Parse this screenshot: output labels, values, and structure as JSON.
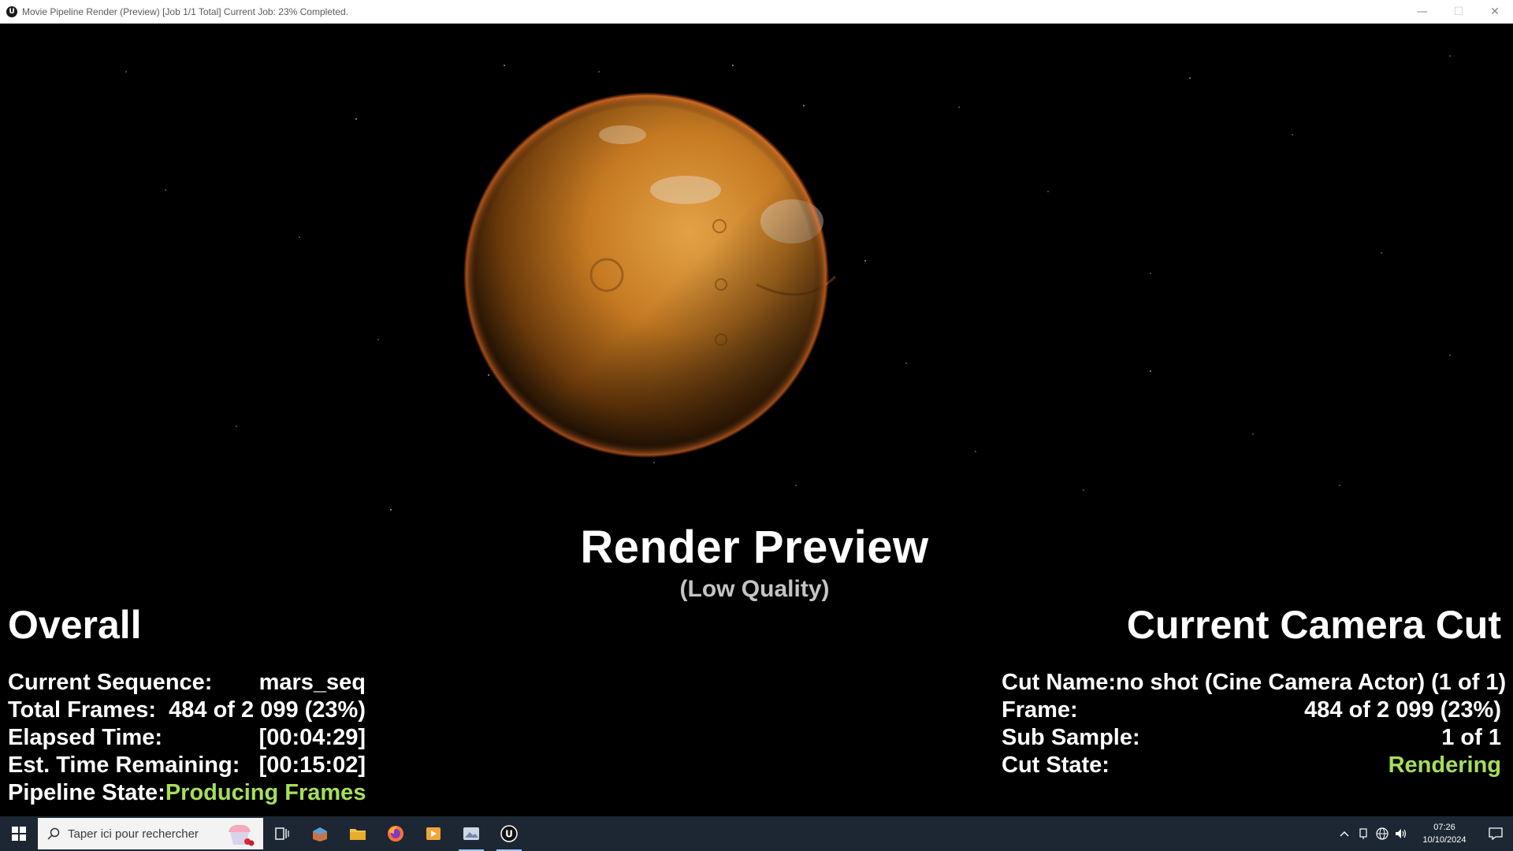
{
  "window": {
    "title": "Movie Pipeline Render (Preview) [Job 1/1 Total] Current Job: 23% Completed.",
    "logo_glyph": "U",
    "controls": [
      "—",
      "☐",
      "✕"
    ]
  },
  "preview": {
    "title": "Render Preview",
    "subtitle": "(Low Quality)"
  },
  "overall": {
    "heading": "Overall",
    "rows": [
      {
        "label": "Current Sequence:",
        "value": "mars_seq"
      },
      {
        "label": "Total Frames:",
        "value": "484 of 2 099 (23%)"
      },
      {
        "label": "Elapsed Time:",
        "value": "[00:04:29]"
      },
      {
        "label": "Est. Time Remaining:",
        "value": "[00:15:02]"
      },
      {
        "label": "Pipeline State:",
        "value": "Producing Frames"
      }
    ]
  },
  "camera_cut": {
    "heading": "Current Camera Cut",
    "rows": [
      {
        "label": "Cut Name:",
        "value": "no shot (Cine Camera Actor) (1 of 1)"
      },
      {
        "label": "Frame:",
        "value": "484 of 2 099 (23%)"
      },
      {
        "label": "Sub Sample:",
        "value": "1 of 1"
      },
      {
        "label": "Cut State:",
        "value": "Rendering"
      }
    ]
  },
  "colors": {
    "status_green": "#a6df5a",
    "taskbar": "#1c2733",
    "planet": "#c57a22"
  },
  "taskbar": {
    "search_placeholder": "Taper ici pour rechercher",
    "apps": [
      "task-view-icon",
      "3d-app-icon",
      "file-explorer-icon",
      "firefox-icon",
      "media-player-icon",
      "image-viewer-icon",
      "unreal-engine-icon"
    ],
    "clock_time": "07:26",
    "clock_date": "10/10/2024"
  }
}
